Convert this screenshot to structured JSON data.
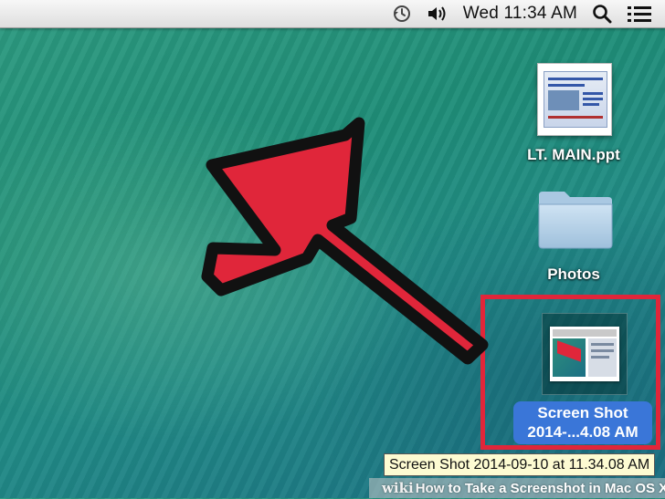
{
  "menubar": {
    "clock": "Wed 11:34 AM",
    "icons": [
      "time-machine-icon",
      "volume-icon",
      "spotlight-search-icon",
      "notification-center-icon"
    ]
  },
  "desktop": {
    "items": [
      {
        "label": "LT. MAIN.ppt",
        "icon": "powerpoint-document-icon"
      },
      {
        "label": "Photos",
        "icon": "folder-icon"
      },
      {
        "label_line1": "Screen Shot",
        "label_line2": "2014-...4.08 AM",
        "icon": "screenshot-file-icon",
        "selected": true
      }
    ]
  },
  "tooltip": {
    "text": "Screen Shot 2014-09-10 at 11.34.08 AM"
  },
  "overlay": {
    "arrow_color": "#e0263a",
    "highlight_color": "#e0263a"
  },
  "watermark": {
    "brand": "wiki",
    "how": "How",
    "title": " to Take a Screenshot in Mac OS X"
  }
}
